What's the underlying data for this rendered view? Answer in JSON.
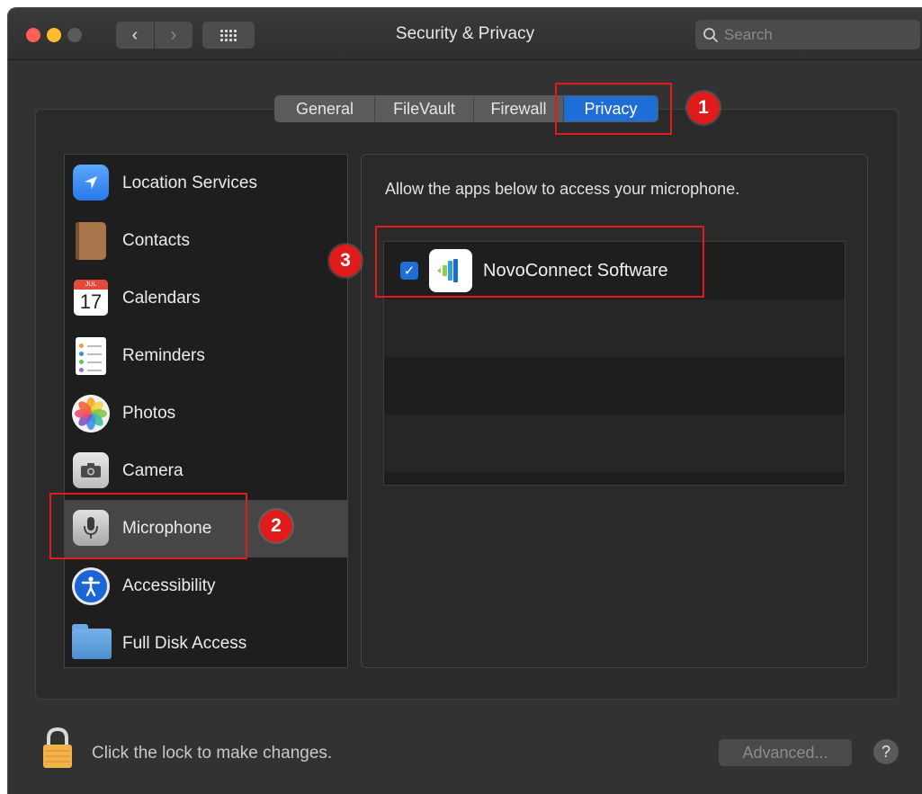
{
  "window": {
    "title": "Security & Privacy",
    "search_placeholder": "Search"
  },
  "tabs": [
    {
      "label": "General",
      "selected": false
    },
    {
      "label": "FileVault",
      "selected": false
    },
    {
      "label": "Firewall",
      "selected": false
    },
    {
      "label": "Privacy",
      "selected": true
    }
  ],
  "sidebar": {
    "items": [
      {
        "label": "Location Services",
        "icon": "location-arrow-icon"
      },
      {
        "label": "Contacts",
        "icon": "contacts-book-icon"
      },
      {
        "label": "Calendars",
        "icon": "calendar-icon",
        "calendar_month": "JUL",
        "calendar_day": "17"
      },
      {
        "label": "Reminders",
        "icon": "reminders-list-icon"
      },
      {
        "label": "Photos",
        "icon": "photos-flower-icon"
      },
      {
        "label": "Camera",
        "icon": "camera-icon"
      },
      {
        "label": "Microphone",
        "icon": "microphone-icon",
        "selected": true
      },
      {
        "label": "Accessibility",
        "icon": "accessibility-person-icon"
      },
      {
        "label": "Full Disk Access",
        "icon": "folder-icon"
      }
    ]
  },
  "privacy_pane": {
    "description": "Allow the apps below to access your microphone.",
    "apps": [
      {
        "name": "NovoConnect Software",
        "checked": true,
        "icon": "novoconnect-app-icon"
      }
    ]
  },
  "annotations": {
    "step1": "1",
    "step2": "2",
    "step3": "3",
    "color": "#e01b1b"
  },
  "footer": {
    "lock_text": "Click the lock to make changes.",
    "advanced_label": "Advanced...",
    "help_label": "?"
  },
  "colors": {
    "accent": "#1f6dd6",
    "window_bg": "#323232"
  }
}
